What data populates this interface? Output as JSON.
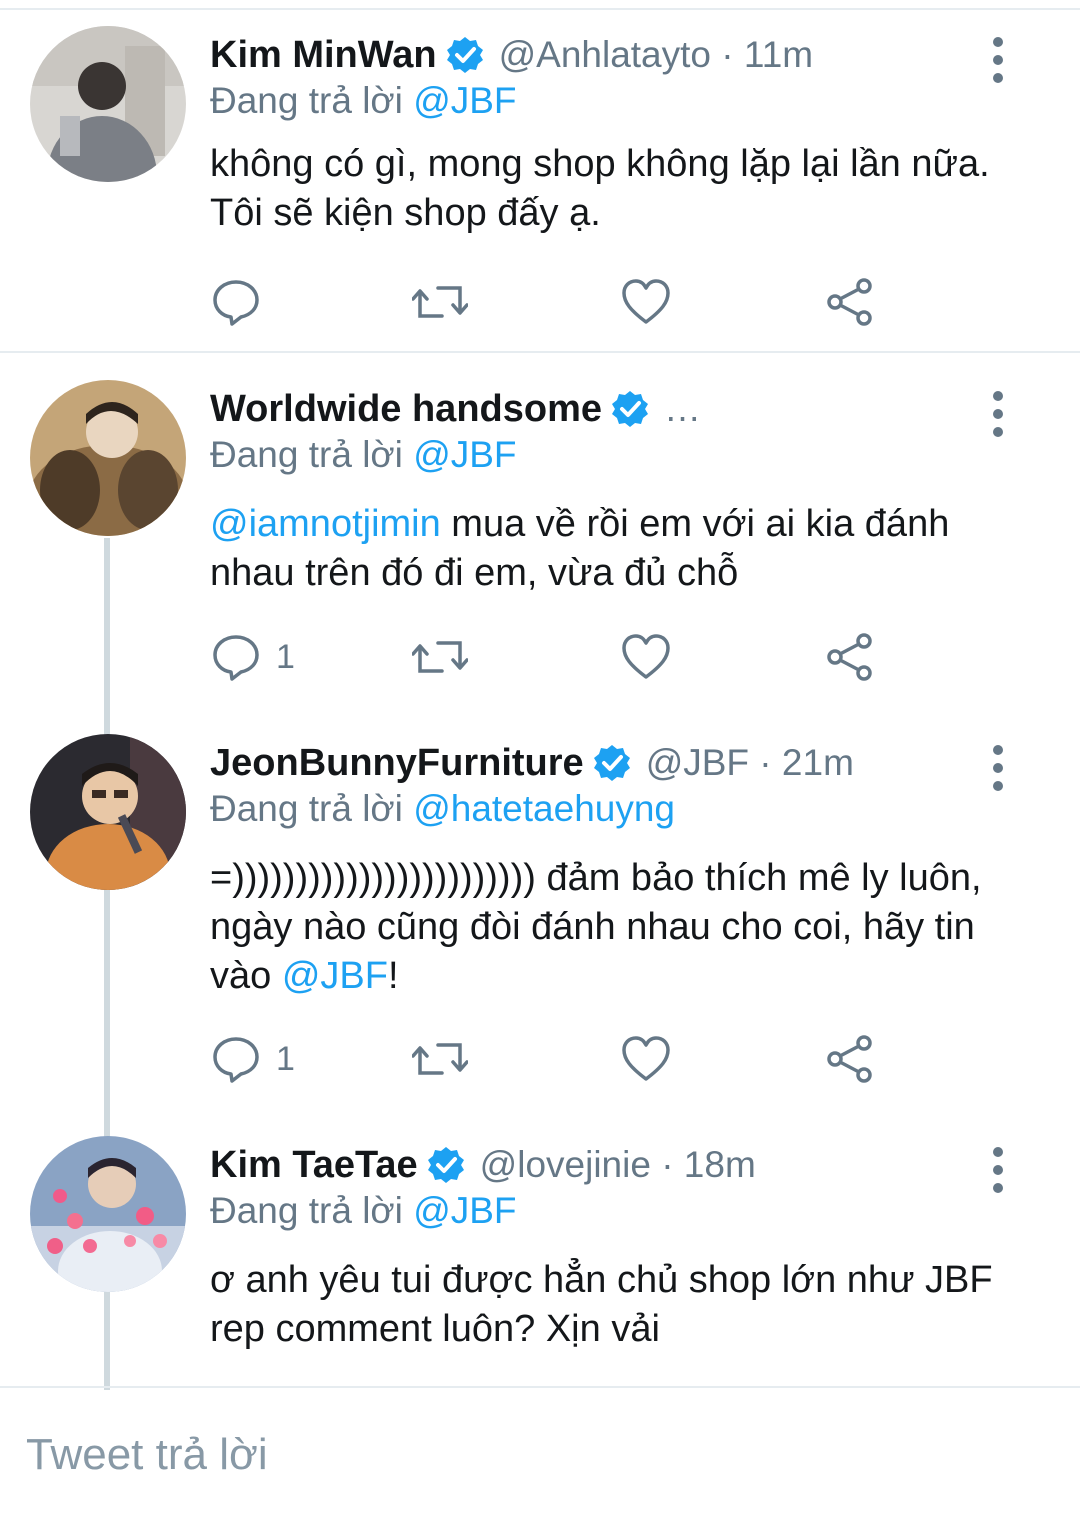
{
  "accent_color": "#1da1f2",
  "tweets": [
    {
      "name": "Kim MinWan",
      "verified": true,
      "handle_time": "@Anhlatayto · 11m",
      "replying_prefix": "Đang trả lời",
      "replying_to": "@JBF",
      "body": "không có gì, mong shop không lặp lại lần nữa. Tôi sẽ kiện shop đấy ạ.",
      "reply_count": ""
    },
    {
      "name": "Worldwide handsome",
      "verified": true,
      "handle_time": "…",
      "replying_prefix": "Đang trả lời",
      "replying_to": "@JBF",
      "body_mention": "@iamnotjimin",
      "body": " mua về rồi em với ai kia đánh nhau trên đó đi em, vừa đủ chỗ",
      "reply_count": "1"
    },
    {
      "name": "JeonBunnyFurniture",
      "verified": true,
      "handle_time": "@JBF · 21m",
      "replying_prefix": "Đang trả lời",
      "replying_to": "@hatetaehuyng",
      "body": "=)))))))))))))))))))))))) đảm bảo thích mê ly luôn, ngày nào cũng đòi đánh nhau cho coi, hãy tin vào ",
      "body_mention_end": "@JBF",
      "body_end": "!",
      "reply_count": "1"
    },
    {
      "name": "Kim TaeTae",
      "verified": true,
      "handle_time": "@lovejinie · 18m",
      "replying_prefix": "Đang trả lời",
      "replying_to": "@JBF",
      "body": "ơ anh yêu tui được hẳn chủ shop lớn như JBF rep comment luôn? Xịn vải"
    }
  ],
  "composer": {
    "placeholder": "Tweet trả lời"
  }
}
